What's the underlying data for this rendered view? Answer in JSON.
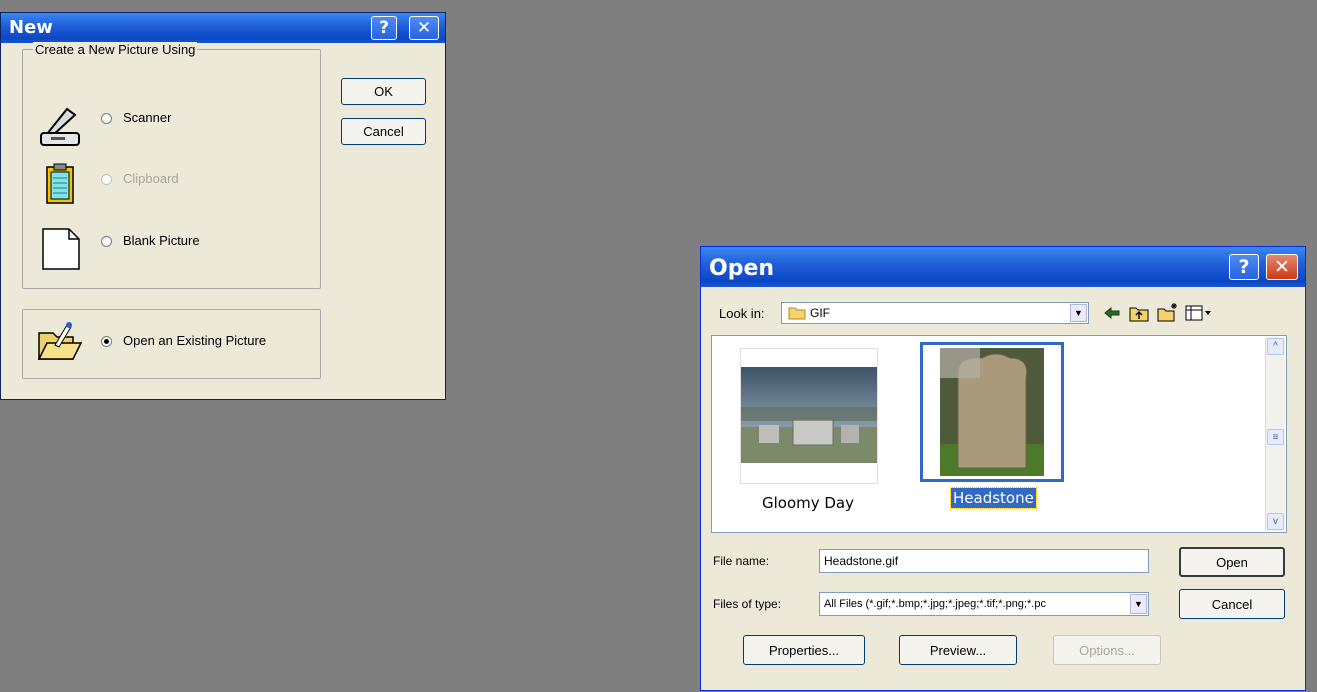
{
  "new_dialog": {
    "title": "New",
    "help_glyph": "?",
    "close_glyph": "✕",
    "group_label": "Create a New Picture Using",
    "options": [
      {
        "label": "Scanner",
        "icon": "scanner-icon",
        "enabled": true,
        "checked": false
      },
      {
        "label": "Clipboard",
        "icon": "clipboard-icon",
        "enabled": false,
        "checked": false
      },
      {
        "label": "Blank Picture",
        "icon": "blank-page-icon",
        "enabled": true,
        "checked": false
      }
    ],
    "open_existing": {
      "label": "Open an Existing Picture",
      "icon": "open-folder-icon",
      "checked": true
    },
    "ok_label": "OK",
    "cancel_label": "Cancel"
  },
  "open_dialog": {
    "title": "Open",
    "help_glyph": "?",
    "close_glyph": "✕",
    "look_in_label": "Look in:",
    "look_in_value": "GIF",
    "files": [
      {
        "name": "Gloomy Day",
        "selected": false
      },
      {
        "name": "Headstone",
        "selected": true
      }
    ],
    "file_name_label": "File name:",
    "file_name_value": "Headstone.gif",
    "files_of_type_label": "Files of type:",
    "files_of_type_value": "All Files (*.gif;*.bmp;*.jpg;*.jpeg;*.tif;*.png;*.pc",
    "open_label": "Open",
    "cancel_label": "Cancel",
    "properties_label": "Properties...",
    "preview_label": "Preview...",
    "options_label": "Options..."
  },
  "colors": {
    "desktop": "#7f7f7f",
    "dialog_face": "#ece9d8",
    "titlebar": "#0b47c4",
    "selection": "#316ac5"
  }
}
